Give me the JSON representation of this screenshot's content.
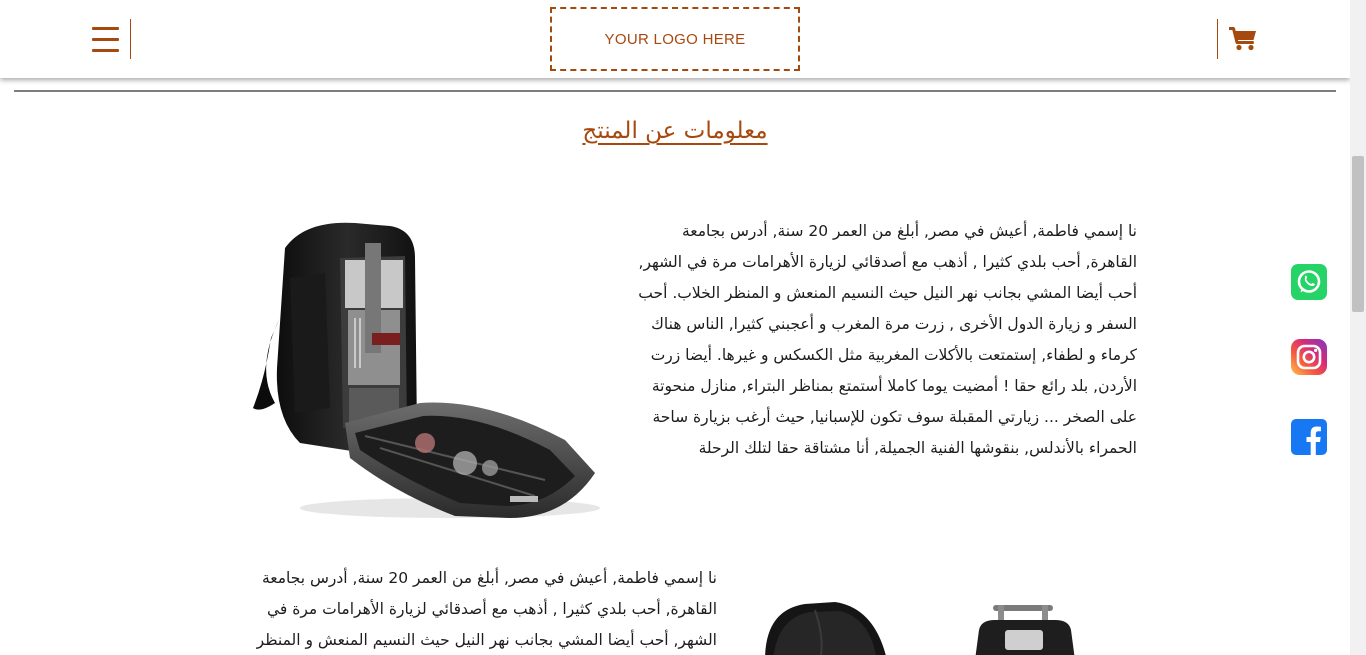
{
  "header": {
    "logo_text": "YOUR LOGO HERE",
    "menu_icon": "hamburger-menu-icon",
    "cart_icon": "shopping-cart-icon"
  },
  "section": {
    "title": "معلومات عن المنتج"
  },
  "paragraphs": [
    "نا إسمي فاطمة, أعيش في مصر, أبلغ من العمر 20 سنة, أدرس بجامعة القاهرة, أحب بلدي كثيرا , أذهب مع أصدقائي لزيارة الأهرامات مرة في الشهر, أحب أيضا المشي بجانب نهر النيل حيث النسيم المنعش و المنظر الخلاب. أحب السفر و زيارة الدول الأخرى , زرت مرة المغرب و أعجبني كثيرا, الناس هناك كرماء و لطفاء, إستمتعت بالأكلات المغربية مثل الكسكس و غيرها. أيضا زرت الأردن, بلد رائع حقا ! أمضيت يوما كاملا أستمتع بمناظر البتراء, منازل منحوتة على الصخر ... زيارتي المقبلة سوف تكون للإسبانيا, حيث أرغب بزيارة ساحة الحمراء بالأندلس, بنقوشها الفنية الجميلة, أنا مشتاقة حقا لتلك الرحلة",
    "نا إسمي فاطمة, أعيش في مصر, أبلغ من العمر 20 سنة, أدرس بجامعة القاهرة, أحب بلدي كثيرا , أذهب مع أصدقائي لزيارة الأهرامات مرة في الشهر, أحب أيضا المشي بجانب نهر النيل حيث النسيم المنعش و المنظر"
  ],
  "social": [
    "whatsapp-icon",
    "instagram-icon",
    "facebook-icon"
  ],
  "colors": {
    "accent": "#a6490f",
    "whatsapp": "#25d366",
    "facebook": "#1877f2"
  }
}
